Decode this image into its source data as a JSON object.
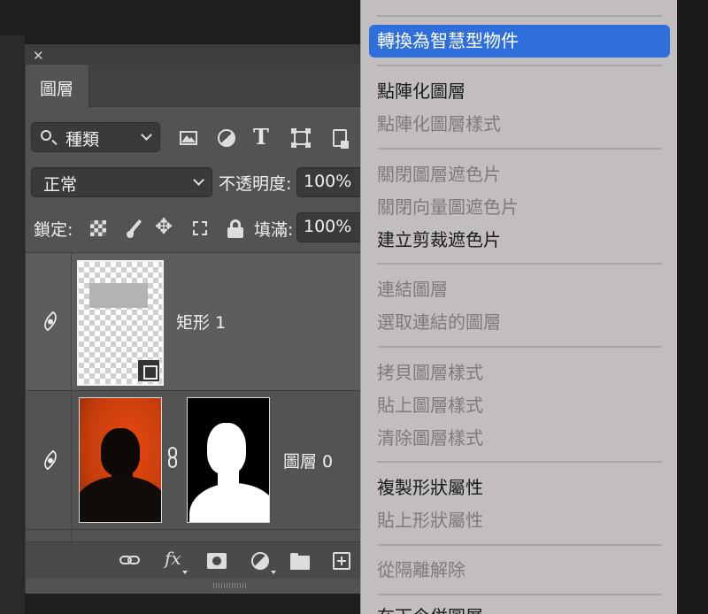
{
  "layers_panel": {
    "tab_label": "圖層",
    "filter": {
      "value": "種類"
    },
    "blend_mode": {
      "value": "正常"
    },
    "opacity": {
      "label": "不透明度:",
      "value": "100%"
    },
    "lock": {
      "label": "鎖定:"
    },
    "fill": {
      "label": "填滿:",
      "value": "100%"
    },
    "layers": [
      {
        "name": "矩形 1",
        "type": "shape",
        "visible": true,
        "selected": true
      },
      {
        "name": "圖層 0",
        "type": "pixel-with-mask",
        "visible": true,
        "selected": false
      }
    ],
    "bottom_icons": [
      "link-layers-icon",
      "fx-icon",
      "add-mask-icon",
      "adjustment-layer-icon",
      "group-folder-icon",
      "new-layer-icon"
    ],
    "fx_text": "fx"
  },
  "context_menu": {
    "items": [
      {
        "label": "轉換為智慧型物件",
        "state": "highlighted"
      },
      {
        "label": "點陣化圖層",
        "state": "enabled"
      },
      {
        "label": "點陣化圖層樣式",
        "state": "disabled"
      },
      {
        "label": "關閉圖層遮色片",
        "state": "disabled"
      },
      {
        "label": "關閉向量圖遮色片",
        "state": "disabled"
      },
      {
        "label": "建立剪裁遮色片",
        "state": "enabled"
      },
      {
        "label": "連結圖層",
        "state": "disabled"
      },
      {
        "label": "選取連結的圖層",
        "state": "disabled"
      },
      {
        "label": "拷貝圖層樣式",
        "state": "disabled"
      },
      {
        "label": "貼上圖層樣式",
        "state": "disabled"
      },
      {
        "label": "清除圖層樣式",
        "state": "disabled"
      },
      {
        "label": "複製形狀屬性",
        "state": "enabled"
      },
      {
        "label": "貼上形狀屬性",
        "state": "disabled"
      },
      {
        "label": "從隔離解除",
        "state": "disabled"
      },
      {
        "label": "在下今併圖層",
        "state": "enabled"
      }
    ]
  },
  "colors": {
    "highlight": "#2f6fdb",
    "panel_bg": "#535353",
    "menu_bg": "#c2bec0",
    "canvas_orange": "#e8490f"
  }
}
